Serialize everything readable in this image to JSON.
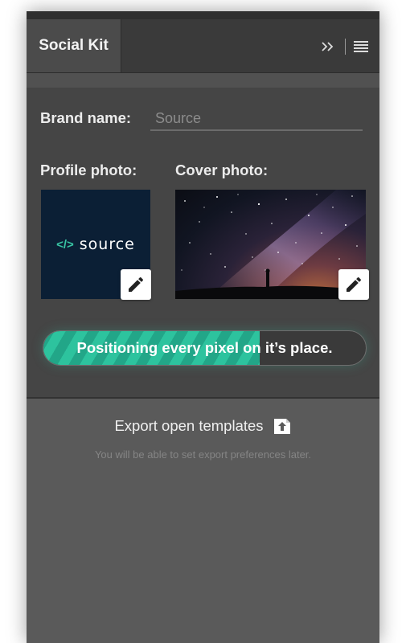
{
  "panel": {
    "tab_title": "Social Kit",
    "header_icons": [
      "expand-icon",
      "menu-icon"
    ]
  },
  "form": {
    "brand_label": "Brand name:",
    "brand_placeholder": "Source",
    "profile_label": "Profile photo:",
    "cover_label": "Cover photo:",
    "profile_logo": {
      "code_glyph": "</>",
      "text": "source"
    }
  },
  "progress": {
    "text": "Positioning every pixel on it’s place.",
    "percent": 67
  },
  "export": {
    "label": "Export open templates",
    "hint": "You will be able to set export preferences later."
  },
  "colors": {
    "accent": "#2dc39e",
    "panel_bg": "#4b4b4b",
    "export_bg": "#5a5a5a"
  }
}
